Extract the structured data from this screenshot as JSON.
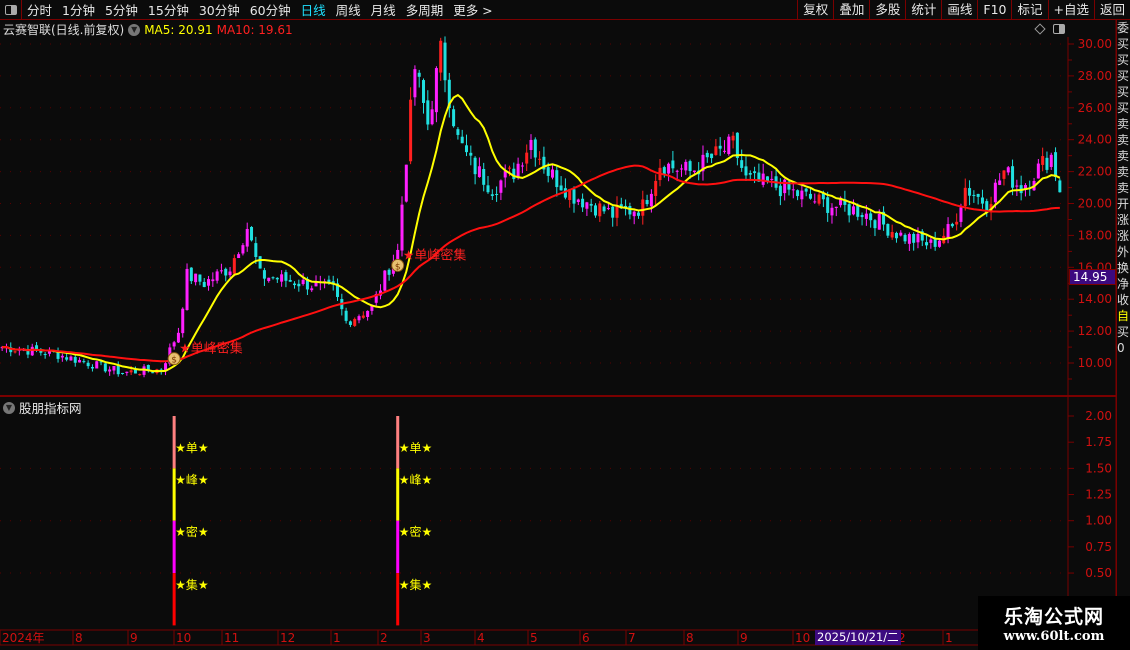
{
  "toolbar": {
    "periods": [
      "分时",
      "1分钟",
      "5分钟",
      "15分钟",
      "30分钟",
      "60分钟",
      "日线",
      "周线",
      "月线",
      "多周期",
      "更多 >"
    ],
    "active_period": "日线",
    "actions": [
      "复权",
      "叠加",
      "多股",
      "统计",
      "画线",
      "F10",
      "标记",
      "+自选",
      "返回"
    ]
  },
  "chart": {
    "title": "云赛智联(日线.前复权)",
    "ma5_label": "MA5: 20.91",
    "ma10_label": "MA10: 19.61",
    "current_price": "14.95",
    "price_ticks": [
      "30.00",
      "28.00",
      "26.00",
      "24.00",
      "22.00",
      "20.00",
      "18.00",
      "16.00",
      "14.00",
      "12.00",
      "10.00"
    ],
    "signal_label": "★单峰密集",
    "signal_bars": [
      40,
      92
    ],
    "price_path": [
      [
        0,
        11
      ],
      [
        12,
        10.6
      ],
      [
        28,
        9.4
      ],
      [
        37,
        9.6
      ],
      [
        41,
        12
      ],
      [
        43,
        15.5
      ],
      [
        47,
        15
      ],
      [
        53,
        16
      ],
      [
        57,
        18.5
      ],
      [
        60,
        15.5
      ],
      [
        70,
        15
      ],
      [
        77,
        14.6
      ],
      [
        80,
        12.6
      ],
      [
        86,
        13.5
      ],
      [
        90,
        16
      ],
      [
        92,
        17
      ],
      [
        94,
        23
      ],
      [
        96,
        28.5
      ],
      [
        99,
        25
      ],
      [
        102,
        29.5
      ],
      [
        106,
        24
      ],
      [
        109,
        22.5
      ],
      [
        114,
        21
      ],
      [
        119,
        22
      ],
      [
        123,
        24
      ],
      [
        127,
        22
      ],
      [
        133,
        20.5
      ],
      [
        142,
        19.3
      ],
      [
        149,
        19.8
      ],
      [
        153,
        22.5
      ],
      [
        160,
        22
      ],
      [
        170,
        23.7
      ],
      [
        173,
        21.5
      ],
      [
        181,
        21
      ],
      [
        191,
        20
      ],
      [
        200,
        19.5
      ],
      [
        209,
        18
      ],
      [
        216,
        17.4
      ],
      [
        221,
        18.5
      ],
      [
        224,
        21
      ],
      [
        229,
        20
      ],
      [
        233,
        22
      ],
      [
        237,
        21
      ],
      [
        242,
        22.5
      ],
      [
        244,
        23
      ],
      [
        246,
        20.9
      ]
    ],
    "colors": {
      "up": "#ff20ff",
      "down": "#20e0e0",
      "ma5": "#ffff00",
      "ma10": "#ff1010",
      "axis": "#7a0000"
    }
  },
  "indicator": {
    "title": "股朋指标网",
    "ticks": [
      "2.00",
      "1.75",
      "1.50",
      "1.25",
      "1.00",
      "0.75",
      "0.50"
    ],
    "labels": [
      "★单★",
      "★峰★",
      "★密★",
      "★集★"
    ]
  },
  "date_axis": {
    "labels": [
      "2024年",
      "8",
      "9",
      "10",
      "11",
      "12",
      "1",
      "2",
      "3",
      "4",
      "5",
      "6",
      "7",
      "8",
      "9",
      "10",
      "2",
      "1"
    ],
    "cursor_date": "2025/10/21/二"
  },
  "side_strip": [
    "委",
    "买",
    "买",
    "买",
    "买",
    "买",
    "卖",
    "卖",
    "卖",
    "卖",
    "卖",
    "开",
    "涨",
    "涨",
    "外",
    "换",
    "净",
    "收",
    "自",
    "买",
    "0"
  ],
  "watermark": {
    "name": "乐淘公式网",
    "url": "www.60lt.com"
  }
}
